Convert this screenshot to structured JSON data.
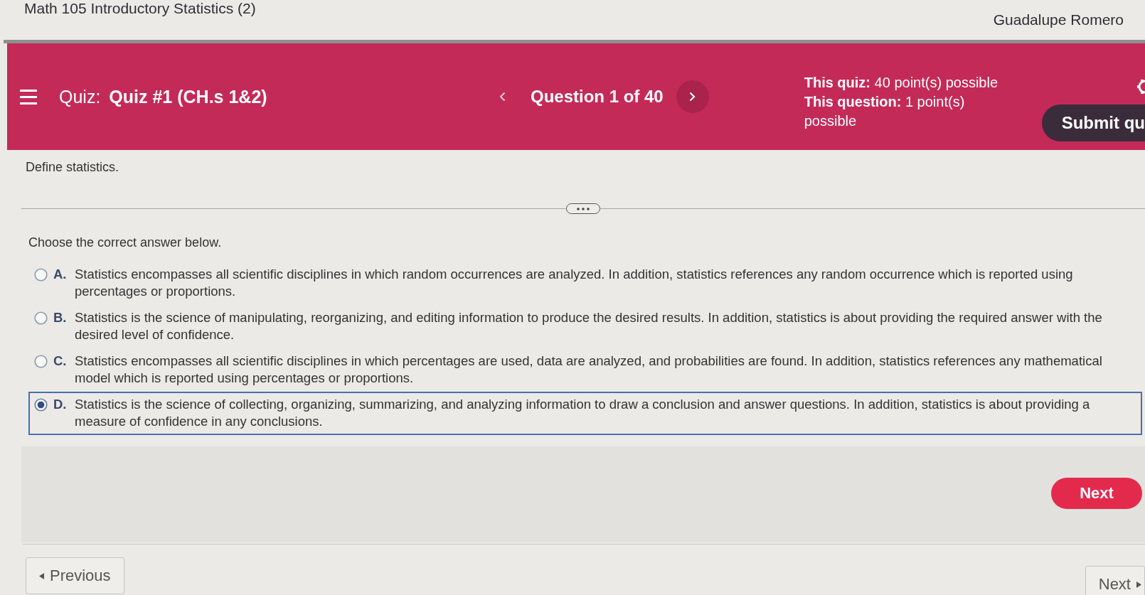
{
  "course_title": "Math 105 Introductory Statistics (2)",
  "user_name": "Guadalupe Romero",
  "quiz_bar": {
    "label": "Quiz:",
    "quiz_name": "Quiz #1 (CH.s 1&2)",
    "question_counter": "Question 1 of 40",
    "quiz_points": "**This quiz:** 40 point(s) possible",
    "question_points": "**This question:** 1 point(s) possible",
    "submit_button": "Submit qu"
  },
  "question": "Define statistics.",
  "instruction": "Choose the correct answer below.",
  "options": [
    {
      "letter": "A.",
      "text": "Statistics encompasses all scientific disciplines in which random occurrences are analyzed. In addition, statistics references any random occurrence which is reported using percentages or proportions.",
      "selected": false
    },
    {
      "letter": "B.",
      "text": "Statistics is the science of manipulating, reorganizing, and editing information to produce the desired results. In addition, statistics is about providing the required answer with the desired level of confidence.",
      "selected": false
    },
    {
      "letter": "C.",
      "text": "Statistics encompasses all scientific disciplines in which percentages are used, data are analyzed, and probabilities are found. In addition, statistics references any mathematical model which is reported using percentages or proportions.",
      "selected": false
    },
    {
      "letter": "D.",
      "text": "Statistics is the science of collecting, organizing, summarizing, and analyzing information to draw a conclusion and answer questions. In addition, statistics is about providing a measure of confidence in any conclusions.",
      "selected": true
    }
  ],
  "next_button": "Next",
  "footer": {
    "previous_button": "Previous",
    "next_button": "Next"
  }
}
